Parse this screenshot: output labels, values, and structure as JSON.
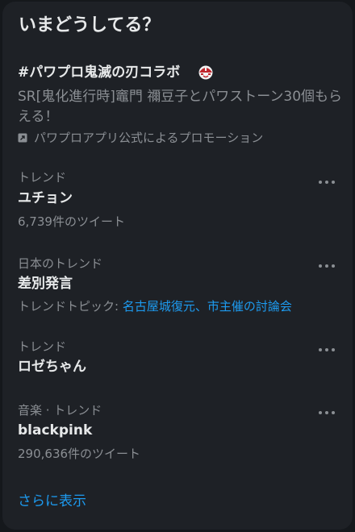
{
  "header": {
    "title": "いまどうしてる？"
  },
  "promo": {
    "title": "#パワプロ鬼滅の刃コラボ",
    "description": "SR[鬼化進行時]竈門 禰豆子とパワストーン30個もらえる！",
    "promoted_by": "パワプロアプリ公式によるプロモーション"
  },
  "trends": [
    {
      "context": "トレンド",
      "name": "ユチョン",
      "detail": "6,739件のツイート"
    },
    {
      "context": "日本のトレンド",
      "name": "差別発言",
      "topic_prefix": "トレンドトピック: ",
      "topic_links": "名古屋城復元、市主催の討論会"
    },
    {
      "context": "トレンド",
      "name": "ロゼちゃん"
    },
    {
      "context": "音楽 · トレンド",
      "name": "blackpink",
      "detail": "290,636件のツイート"
    }
  ],
  "footer": {
    "show_more": "さらに表示"
  },
  "colors": {
    "accent": "#1d9bf0",
    "panel": "#1e2126",
    "muted": "#8b8f94",
    "text": "#e7e9ea"
  }
}
